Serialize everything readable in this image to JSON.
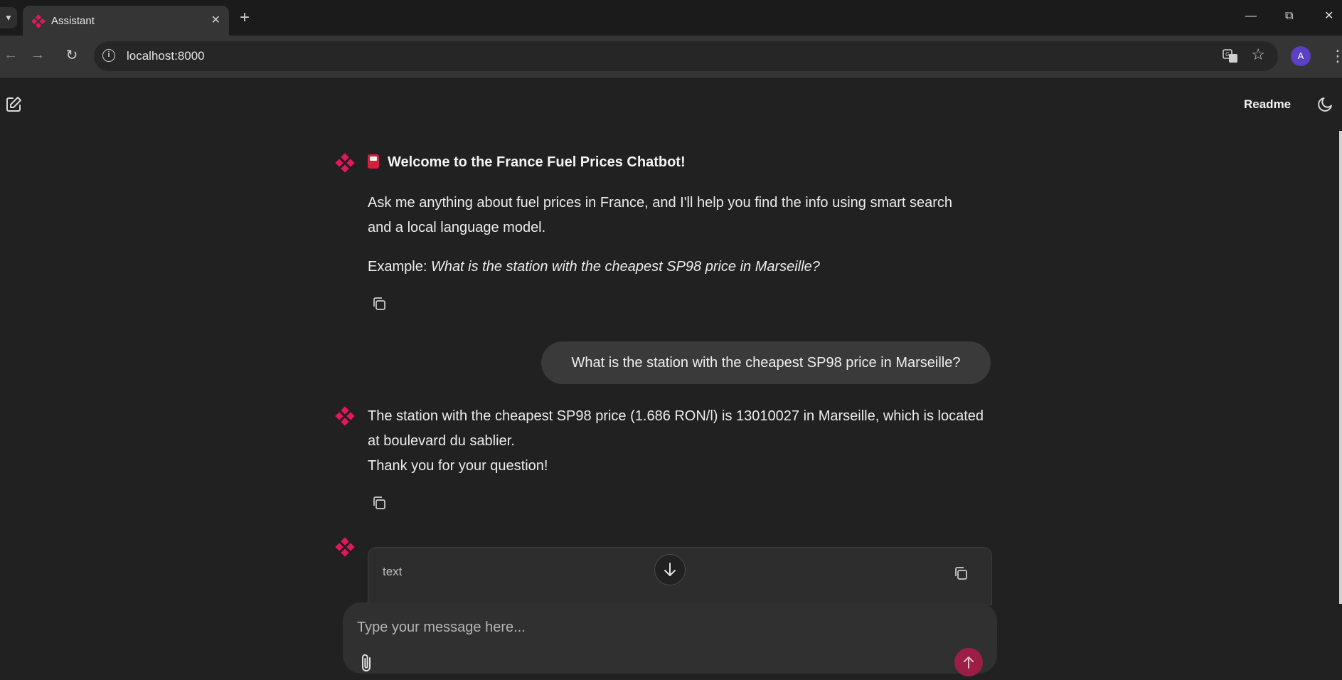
{
  "browser": {
    "tab_title": "Assistant",
    "url": "localhost:8000",
    "avatar_letter": "A"
  },
  "app": {
    "readme_label": "Readme",
    "accent": "#e5175a"
  },
  "messages": {
    "welcome_title": "Welcome to the France Fuel Prices Chatbot!",
    "welcome_body": "Ask me anything about fuel prices in France, and I'll help you find the info using smart search and a local language model.",
    "example_prefix": "Example: ",
    "example_question": "What is the station with the cheapest SP98 price in Marseille?",
    "user_question": "What is the station with the cheapest SP98 price in Marseille?",
    "answer_line1": "The station with the cheapest SP98 price (1.686 RON/l) is 13010027 in Marseille, which is located at boulevard du sablier.",
    "answer_line2": "Thank you for your question!",
    "code_lang": "text"
  },
  "composer": {
    "placeholder": "Type your message here..."
  }
}
